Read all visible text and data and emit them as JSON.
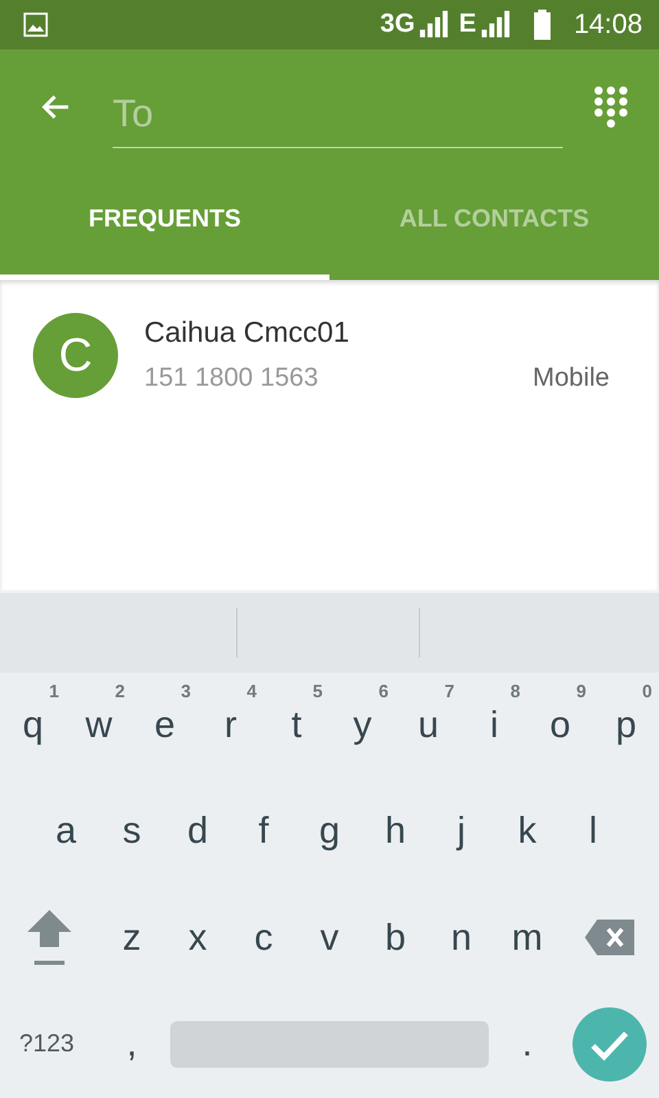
{
  "status_bar": {
    "networks": [
      {
        "label": "3G"
      },
      {
        "label": "E"
      }
    ],
    "time": "14:08"
  },
  "recipient_field": {
    "placeholder": "To"
  },
  "tabs": [
    {
      "label": "FREQUENTS",
      "selected": true
    },
    {
      "label": "ALL CONTACTS",
      "selected": false
    }
  ],
  "contacts": [
    {
      "initial": "C",
      "name": "Caihua Cmcc01",
      "number": "151 1800 1563",
      "type": "Mobile"
    }
  ],
  "keyboard": {
    "letter_rows": [
      {
        "keys": [
          {
            "kind": "letter",
            "label": "q",
            "hint": "1"
          },
          {
            "kind": "letter",
            "label": "w",
            "hint": "2"
          },
          {
            "kind": "letter",
            "label": "e",
            "hint": "3"
          },
          {
            "kind": "letter",
            "label": "r",
            "hint": "4"
          },
          {
            "kind": "letter",
            "label": "t",
            "hint": "5"
          },
          {
            "kind": "letter",
            "label": "y",
            "hint": "6"
          },
          {
            "kind": "letter",
            "label": "u",
            "hint": "7"
          },
          {
            "kind": "letter",
            "label": "i",
            "hint": "8"
          },
          {
            "kind": "letter",
            "label": "o",
            "hint": "9"
          },
          {
            "kind": "letter",
            "label": "p",
            "hint": "0"
          }
        ]
      },
      {
        "keys": [
          {
            "kind": "letter",
            "label": "a"
          },
          {
            "kind": "letter",
            "label": "s"
          },
          {
            "kind": "letter",
            "label": "d"
          },
          {
            "kind": "letter",
            "label": "f"
          },
          {
            "kind": "letter",
            "label": "g"
          },
          {
            "kind": "letter",
            "label": "h"
          },
          {
            "kind": "letter",
            "label": "j"
          },
          {
            "kind": "letter",
            "label": "k"
          },
          {
            "kind": "letter",
            "label": "l"
          }
        ]
      },
      {
        "keys": [
          {
            "kind": "shift"
          },
          {
            "kind": "letter",
            "label": "z"
          },
          {
            "kind": "letter",
            "label": "x"
          },
          {
            "kind": "letter",
            "label": "c"
          },
          {
            "kind": "letter",
            "label": "v"
          },
          {
            "kind": "letter",
            "label": "b"
          },
          {
            "kind": "letter",
            "label": "n"
          },
          {
            "kind": "letter",
            "label": "m"
          },
          {
            "kind": "delete"
          }
        ]
      }
    ],
    "bottom_bar": {
      "symbols_key": "?123",
      "comma_key": ",",
      "period_key": "."
    }
  }
}
